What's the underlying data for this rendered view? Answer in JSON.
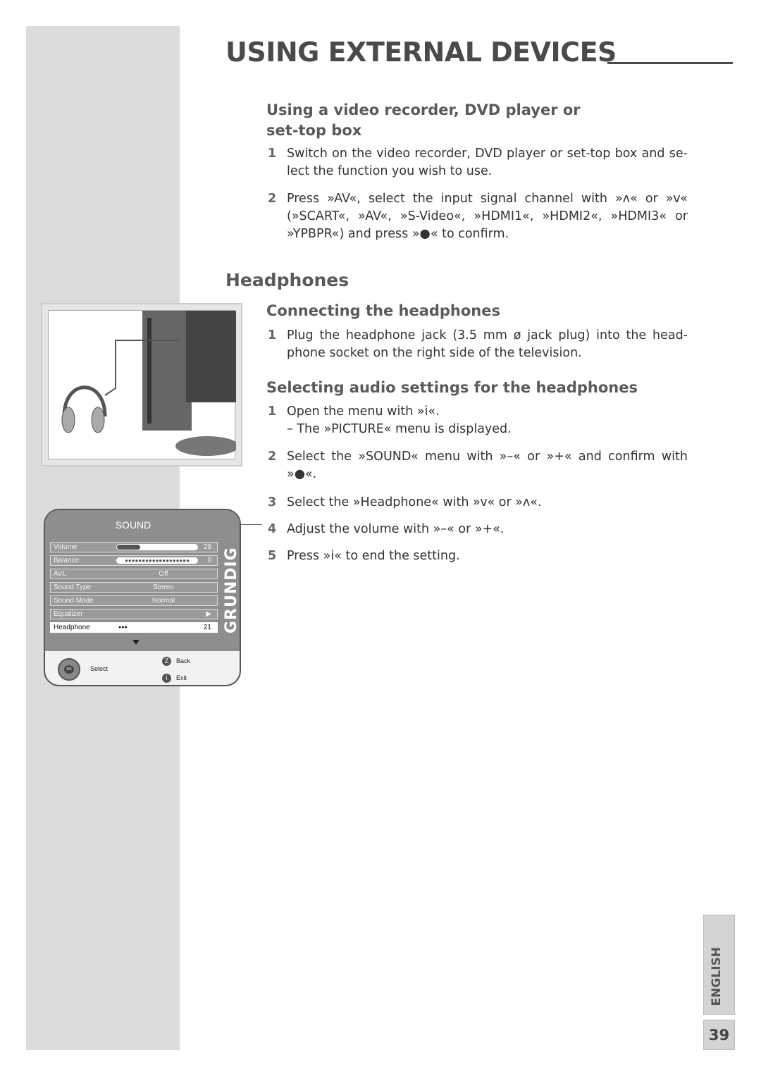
{
  "page_title": "USING EXTERNAL DEVICES",
  "section1": {
    "heading": "Using a video recorder, DVD player or set-top box",
    "steps": [
      {
        "n": "1",
        "text": "Switch on the video recorder, DVD player or set-top box and se-lect the function you wish to use."
      },
      {
        "n": "2",
        "text": "Press »AV«, select the input signal channel with »ʌ« or »v« (»SCART«, »AV«, »S-Video«, »HDMI1«, »HDMI2«, »HDMI3« or »YPBPR«) and press »●« to confirm."
      }
    ]
  },
  "section2": {
    "heading": "Headphones",
    "sub1": {
      "heading": "Connecting the headphones",
      "steps": [
        {
          "n": "1",
          "text": "Plug the headphone jack (3.5 mm ø jack plug) into the head-phone socket on the right side of the television."
        }
      ]
    },
    "sub2": {
      "heading": "Selecting audio settings for the headphones",
      "steps": [
        {
          "n": "1",
          "text": "Open the menu with »i«.",
          "note": "– The »PICTURE« menu is displayed."
        },
        {
          "n": "2",
          "text": "Select the »SOUND« menu with »–« or »+« and confirm with »●«."
        },
        {
          "n": "3",
          "text": "Select the »Headphone« with »v« or »ʌ«."
        },
        {
          "n": "4",
          "text": "Adjust the volume with »–« or »+«."
        },
        {
          "n": "5",
          "text": "Press »i« to end the setting."
        }
      ]
    }
  },
  "sound_menu": {
    "title": "SOUND",
    "brand": "GRUNDIG",
    "rows": [
      {
        "label": "Volume",
        "value": "",
        "num": "29",
        "level": 0.29
      },
      {
        "label": "Balance",
        "value": "",
        "num": "0"
      },
      {
        "label": "AVL",
        "value": "Off",
        "num": ""
      },
      {
        "label": "Sound Type",
        "value": "Stereo",
        "num": ""
      },
      {
        "label": "Sound Mode",
        "value": "Normal",
        "num": ""
      },
      {
        "label": "Equalizer",
        "value": "",
        "num": "▶"
      },
      {
        "label": "Headphone",
        "value": "●●●",
        "num": "21"
      }
    ],
    "select": "Select",
    "ok": "OK",
    "back_key": "Z",
    "back": "Back",
    "exit_key": "i",
    "exit": "Exit"
  },
  "language": "ENGLISH",
  "page_number": "39"
}
